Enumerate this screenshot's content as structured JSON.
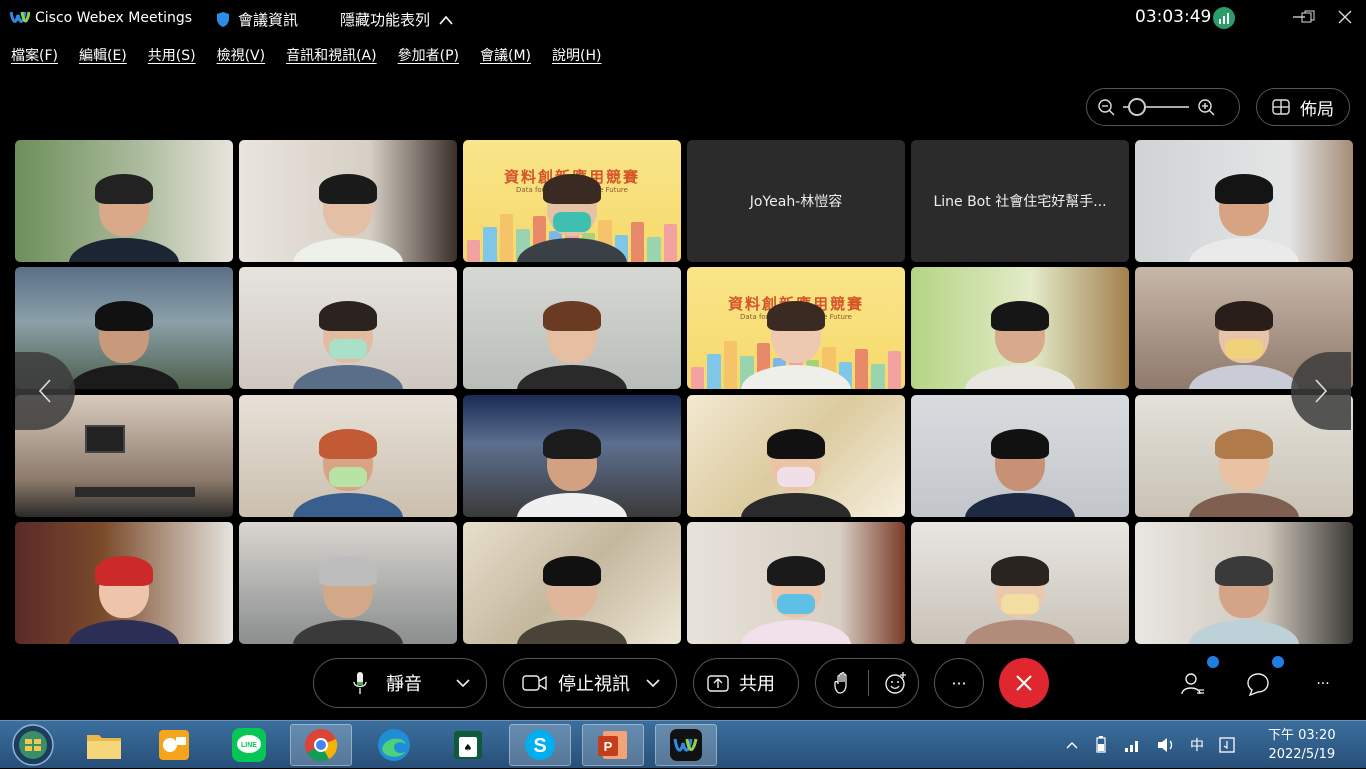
{
  "titlebar": {
    "app_name": "Cisco Webex Meetings",
    "meeting_info": "會議資訊",
    "hide_menu": "隱藏功能表列",
    "clock": "03:03:49"
  },
  "menu": [
    "檔案(F)",
    "編輯(E)",
    "共用(S)",
    "檢視(V)",
    "音訊和視訊(A)",
    "參加者(P)",
    "會議(M)",
    "說明(H)"
  ],
  "view": {
    "layout_label": "佈局",
    "zoom_level": 0.1
  },
  "participants": {
    "name_tiles": [
      "JoYeah-林愷容",
      "Line Bot 社會住宅好幫手..."
    ],
    "banner": {
      "title": "資料創新應用競賽",
      "subtitle": "Data for Live · Shape the Future"
    }
  },
  "controls": {
    "mute_label": "靜音",
    "video_label": "停止視訊",
    "share_label": "共用",
    "more_label": "···",
    "overflow_label": "···"
  },
  "taskbar": {
    "ime": "中",
    "time": "下午 03:20",
    "date": "2022/5/19"
  },
  "colors": {
    "end_call": "#e0262f",
    "notify_dot": "#1f7ee0",
    "signal": "#2a9d6a"
  }
}
